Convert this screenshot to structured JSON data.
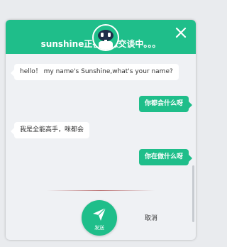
{
  "header": {
    "title": "sunshine正在与您交谈中。。。",
    "close_icon": "close-icon"
  },
  "avatar": {
    "icon": "robot-icon"
  },
  "messages": [
    {
      "from": "bot",
      "text": "hello！ my name's Sunshine,what's your name?"
    },
    {
      "from": "user",
      "text": "你都会什么呀"
    },
    {
      "from": "bot",
      "text": "我是全能高手，咪都会"
    },
    {
      "from": "user",
      "text": "你在做什么呀"
    }
  ],
  "composer": {
    "send_label": "发送",
    "send_icon": "paper-plane-icon",
    "cancel_label": "取消"
  },
  "colors": {
    "brand": "#1fbe8a",
    "panel_bg": "#eff1f4",
    "page_bg": "#e9ebee"
  }
}
